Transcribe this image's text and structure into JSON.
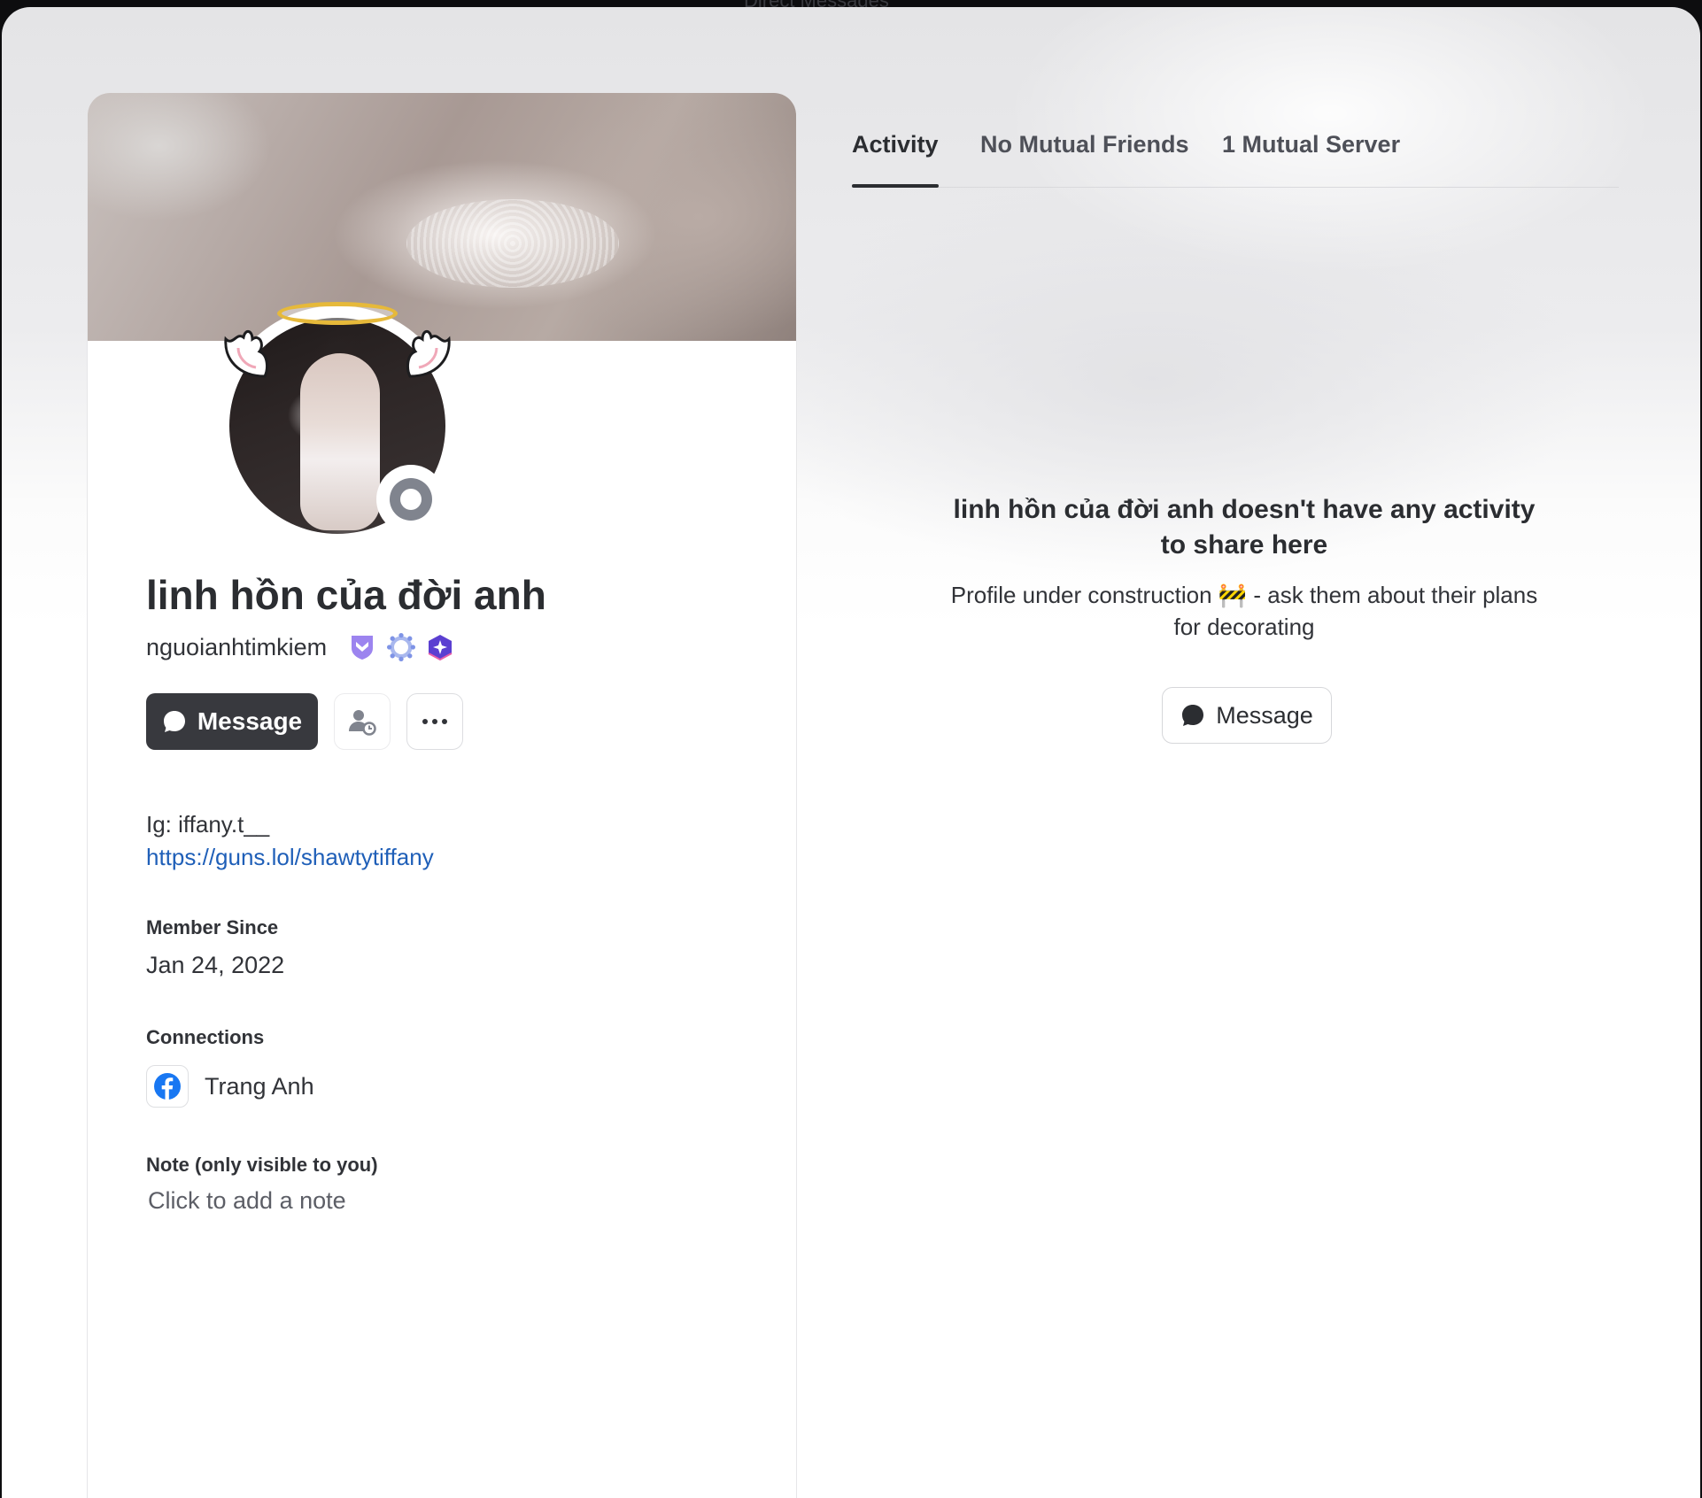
{
  "window": {
    "title": "Direct Messages"
  },
  "profile": {
    "display_name": "linh hồn của đời anh",
    "username": "nguoianhtimkiem",
    "status": "offline",
    "badges": [
      "hypesquad-badge-icon",
      "quest-badge-icon",
      "nitro-badge-icon"
    ],
    "actions": {
      "message_label": "Message"
    },
    "bio": {
      "line1": "Ig: iffany.t__",
      "link": "https://guns.lol/shawtytiffany"
    },
    "member_since": {
      "label": "Member Since",
      "value": "Jan 24, 2022"
    },
    "connections": {
      "label": "Connections",
      "items": [
        {
          "service": "facebook",
          "name": "Trang Anh"
        }
      ]
    },
    "note": {
      "label": "Note (only visible to you)",
      "placeholder": "Click to add a note"
    }
  },
  "tabs": [
    {
      "label": "Activity",
      "active": true
    },
    {
      "label": "No Mutual Friends",
      "active": false
    },
    {
      "label": "1 Mutual Server",
      "active": false
    }
  ],
  "activity": {
    "empty_title": "linh hồn của đời anh doesn't have any activity to share here",
    "empty_subtitle": "Profile under construction 🚧 - ask them about their plans for decorating",
    "message_label": "Message"
  },
  "colors": {
    "primary_button": "#38393e",
    "link": "#1f5fb8",
    "status_offline": "#80848e",
    "facebook": "#1877f2"
  }
}
